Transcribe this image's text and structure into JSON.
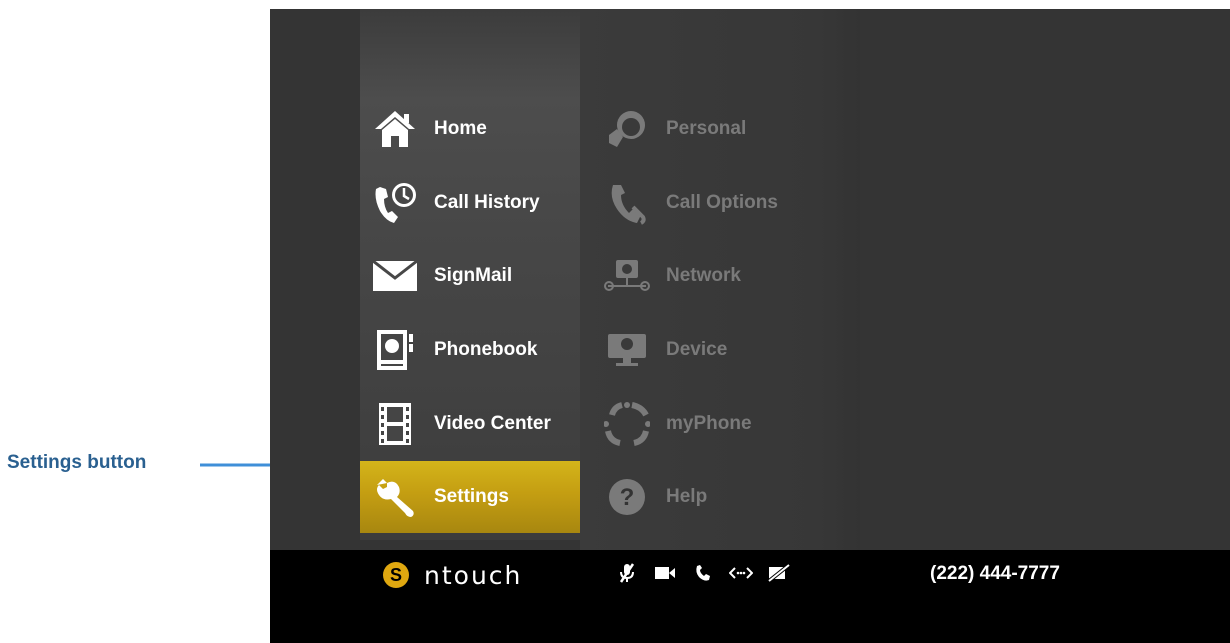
{
  "annotation": {
    "label": "Settings button",
    "color": "#2a6090"
  },
  "main_menu": {
    "items": [
      {
        "id": "home",
        "label": "Home",
        "icon": "home-icon"
      },
      {
        "id": "call-history",
        "label": "Call History",
        "icon": "call-history-icon"
      },
      {
        "id": "signmail",
        "label": "SignMail",
        "icon": "envelope-icon"
      },
      {
        "id": "phonebook",
        "label": "Phonebook",
        "icon": "phonebook-icon"
      },
      {
        "id": "video-center",
        "label": "Video Center",
        "icon": "film-icon"
      },
      {
        "id": "settings",
        "label": "Settings",
        "icon": "wrench-icon",
        "selected": true
      }
    ],
    "selected_color": "#c9a614"
  },
  "settings_submenu": {
    "items": [
      {
        "id": "personal",
        "label": "Personal",
        "icon": "personal-icon"
      },
      {
        "id": "call-options",
        "label": "Call Options",
        "icon": "call-options-icon"
      },
      {
        "id": "network",
        "label": "Network",
        "icon": "network-icon"
      },
      {
        "id": "device",
        "label": "Device",
        "icon": "device-icon"
      },
      {
        "id": "myphone",
        "label": "myPhone",
        "icon": "myphone-icon"
      },
      {
        "id": "help",
        "label": "Help",
        "icon": "help-icon"
      }
    ]
  },
  "status_bar": {
    "brand": "ntouch",
    "phone_number": "(222) 444-7777",
    "icons": [
      "mic-muted-icon",
      "video-camera-icon",
      "phone-icon",
      "remote-icon",
      "video-off-icon"
    ]
  }
}
